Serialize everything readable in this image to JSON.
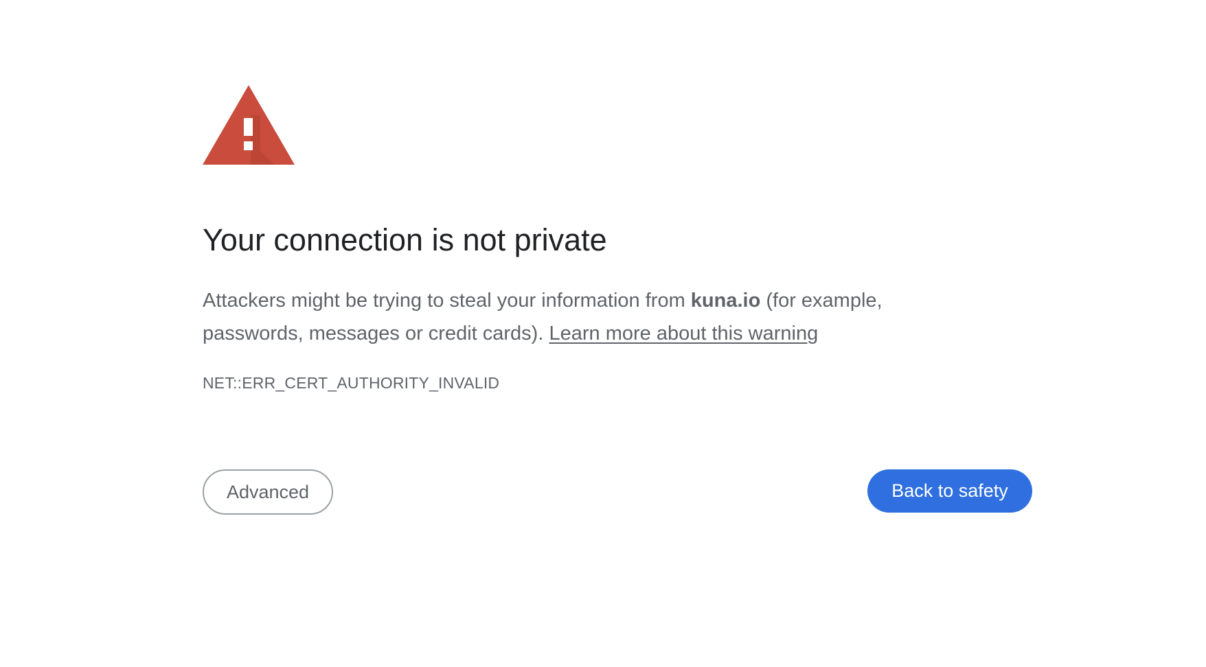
{
  "icon": {
    "name": "warning-triangle-icon",
    "color": "#c94c3c",
    "mark_color": "#ffffff"
  },
  "heading": "Your connection is not private",
  "message": {
    "before_host": "Attackers might be trying to steal your information from ",
    "host": "kuna.io",
    "after_host": " (for example, passwords, messages or credit cards). ",
    "learn_more_link": "Learn more about this warning"
  },
  "error_code": "NET::ERR_CERT_AUTHORITY_INVALID",
  "buttons": {
    "advanced_label": "Advanced",
    "back_label": "Back to safety"
  },
  "colors": {
    "primary_button": "#2f6fdf",
    "heading_text": "#202124",
    "body_text": "#5f6368"
  }
}
